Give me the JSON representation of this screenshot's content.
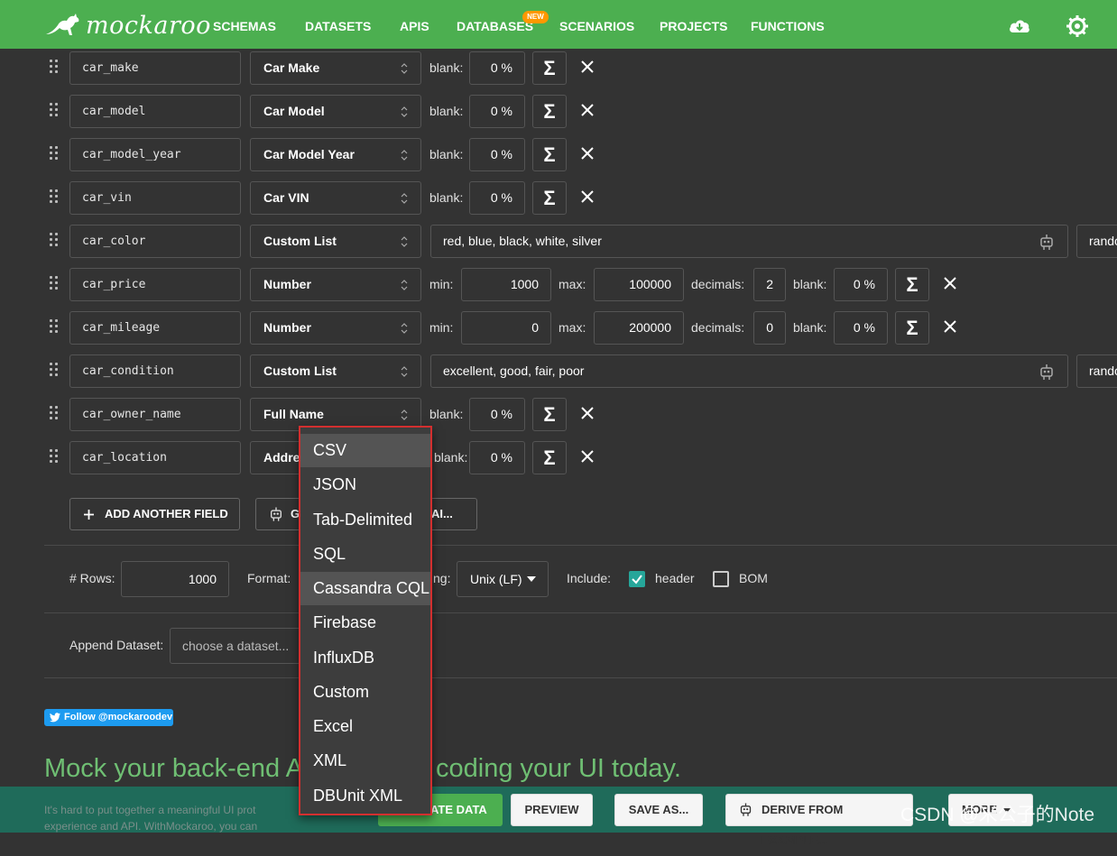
{
  "nav": {
    "logo_text": "mockaroo",
    "items": [
      "SCHEMAS",
      "DATASETS",
      "APIS",
      "DATABASES",
      "SCENARIOS",
      "PROJECTS",
      "FUNCTIONS"
    ],
    "new_badge": "NEW"
  },
  "fields": [
    {
      "name": "car_make",
      "type": "Car Make",
      "blank_label": "blank:",
      "blank": "0 %"
    },
    {
      "name": "car_model",
      "type": "Car Model",
      "blank_label": "blank:",
      "blank": "0 %"
    },
    {
      "name": "car_model_year",
      "type": "Car Model Year",
      "blank_label": "blank:",
      "blank": "0 %"
    },
    {
      "name": "car_vin",
      "type": "Car VIN",
      "blank_label": "blank:",
      "blank": "0 %"
    },
    {
      "name": "car_color",
      "type": "Custom List",
      "values": "red, blue, black, white, silver",
      "order": "rando"
    },
    {
      "name": "car_price",
      "type": "Number",
      "min_label": "min:",
      "min": "1000",
      "max_label": "max:",
      "max": "100000",
      "decimals_label": "decimals:",
      "decimals": "2",
      "blank_label": "blank:",
      "blank": "0 %"
    },
    {
      "name": "car_mileage",
      "type": "Number",
      "min_label": "min:",
      "min": "0",
      "max_label": "max:",
      "max": "200000",
      "decimals_label": "decimals:",
      "decimals": "0",
      "blank_label": "blank:",
      "blank": "0 %"
    },
    {
      "name": "car_condition",
      "type": "Custom List",
      "values": "excellent, good, fair, poor",
      "order": "rando"
    },
    {
      "name": "car_owner_name",
      "type": "Full Name",
      "blank_label": "blank:",
      "blank": "0 %"
    },
    {
      "name": "car_location",
      "type": "Addre",
      "blank_label": "blank:",
      "blank": "0 %"
    }
  ],
  "sigma": "Σ",
  "actions": {
    "add_field": "ADD ANOTHER FIELD",
    "generate_ai_left": "G",
    "generate_ai_right": "AI..."
  },
  "options": {
    "rows_label": "# Rows:",
    "rows": "1000",
    "format_label": "Format:",
    "line_ending_label": "ng:",
    "line_ending": "Unix (LF)",
    "include_label": "Include:",
    "header_label": "header",
    "header_checked": true,
    "bom_label": "BOM",
    "bom_checked": false
  },
  "append": {
    "label": "Append Dataset:",
    "placeholder": "choose a dataset..."
  },
  "format_dropdown": {
    "items": [
      "CSV",
      "JSON",
      "Tab-Delimited",
      "SQL",
      "Cassandra CQL",
      "Firebase",
      "InfluxDB",
      "Custom",
      "Excel",
      "XML",
      "DBUnit XML"
    ],
    "highlighted": [
      "CSV",
      "Cassandra CQL"
    ]
  },
  "follow": "Follow @mockaroodev",
  "hero": {
    "left": "Mock your back-end A",
    "right": "coding your UI today."
  },
  "intro_text": {
    "line1": "It's hard to put together a meaningful UI prot",
    "line2": "experience and API. WithMockaroo, you can"
  },
  "footer": {
    "generate": "ATE DATA",
    "preview": "PREVIEW",
    "save_as": "SAVE AS...",
    "derive": "DERIVE FROM EXAMPLE...",
    "more": "MORE"
  },
  "watermark": "CSDN @米公子的Note",
  "colors": {
    "nav": "#4caf50",
    "accent": "#6fbf73",
    "dropdown_border": "#d32f2f",
    "footer": "#1f6b5a"
  }
}
